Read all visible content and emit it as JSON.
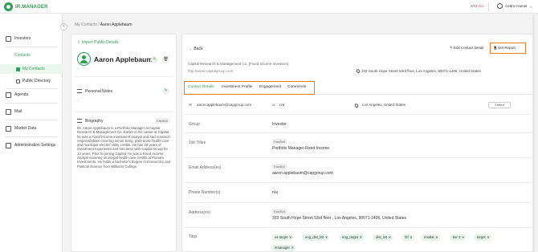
{
  "app": {
    "name": "IR.MANAGER",
    "company": "XYZ Co.",
    "user": "Cedric Hamel"
  },
  "sidebar": {
    "items": [
      {
        "label": "Investors",
        "icon": "investors-icon"
      },
      {
        "label": "Contacts",
        "icon": "contacts-icon"
      },
      {
        "label": "My Contacts",
        "icon": "my-contacts-icon"
      },
      {
        "label": "Public Directory",
        "icon": "public-directory-icon"
      },
      {
        "label": "Agenda",
        "icon": "calendar-icon"
      },
      {
        "label": "Mail",
        "icon": "mail-icon"
      },
      {
        "label": "Market Data",
        "icon": "chart-icon"
      },
      {
        "label": "Administration Settings",
        "icon": "lock-icon"
      }
    ]
  },
  "breadcrumb": {
    "parent": "My Contacts",
    "separator": "/",
    "current": "Aaron Applebaum"
  },
  "profile": {
    "import_label": "Import Public Details",
    "name": "Aaron Applebaum",
    "notes_title": "Personal Notes",
    "notes_value": "-",
    "bio_title": "Biography",
    "bio_badge": "FactSet",
    "bio_text": "Mr. Aaron Applebaum is a Portfolio Manager at Capital Research & Management Co. Earlier in his career at Capital, he was a Fixed Income investment analyst and had research responsibilities covering senior living, post-acute health care and municipal electric utility credits. He has 18 years of investment experience and has been with Capital Group for 13 years. Prior to joining Capital, he was a Fixed Income Analyst covering municipal health care credits at Putnam Investments. He holds a bachelor's degree in Economics and Political Science from Williams College."
  },
  "detail": {
    "back_label": "Back",
    "edit_label": "Edit Contact Detail",
    "report_label": "Get Report",
    "company": "Capital Research & Management Co. (Fixed Income Investors)",
    "url": "http://www.capitalgroup.com",
    "address_top": "333 South Hope Street 53rd floor, Los Angeles, 90071-1406, United States",
    "tabs": [
      "Contact Details",
      "Investment Profile",
      "Engagement",
      "Comments"
    ],
    "email_line": "aaron.applebaum@capgroup.com",
    "phone_line": "n/a",
    "location_line": "Los Angeles, United States",
    "edited_label": "Edited",
    "fields": {
      "group_label": "Group",
      "group_value": "Investor",
      "job_label": "Job Titles",
      "job_badge": "FactSet",
      "job_value": "Portfolio Manager-Fixed Income",
      "email_label": "Email Address(es)",
      "email_badge": "FactSet",
      "email_value": "aaron.applebaum@capgroup.com",
      "phone_label": "Phone Number(s)",
      "phone_value": "n/a",
      "address_label": "Address(es)",
      "address_badge": "FactSet",
      "address_value": "333 South Hope Street 53rd floor , Los Angeles, 90071-1406, United States",
      "tags_label": "Tags"
    },
    "tags": [
      "us target",
      "eng_dist_list",
      "eng_target",
      "dist_list",
      "f2f",
      "rioultat",
      "tier 3",
      "target",
      "irmanager"
    ]
  },
  "colors": {
    "brand": "#2e9e53",
    "highlight": "#f07a1e"
  }
}
